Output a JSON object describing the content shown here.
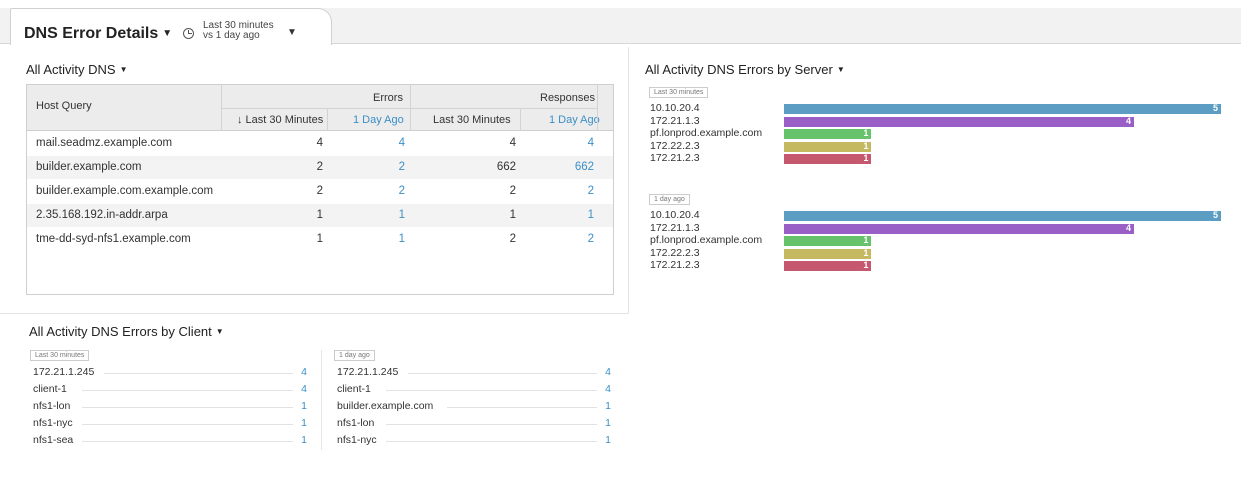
{
  "header": {
    "title": "DNS Error Details",
    "time_line1": "Last 30 minutes",
    "time_line2": "vs 1 day ago"
  },
  "table_section": {
    "title": "All Activity DNS",
    "col_host": "Host Query",
    "group_errors": "Errors",
    "group_responses": "Responses",
    "sub_last": "↓ Last 30 Minutes",
    "sub_ago": "1 Day Ago",
    "sub_last2": "Last 30 Minutes",
    "sub_ago2": "1 Day Ago",
    "rows": [
      {
        "host": "mail.seadmz.example.com",
        "err_last": "4",
        "err_ago": "4",
        "resp_last": "4",
        "resp_ago": "4"
      },
      {
        "host": "builder.example.com",
        "err_last": "2",
        "err_ago": "2",
        "resp_last": "662",
        "resp_ago": "662"
      },
      {
        "host": "builder.example.com.example.com",
        "err_last": "2",
        "err_ago": "2",
        "resp_last": "2",
        "resp_ago": "2"
      },
      {
        "host": "2.35.168.192.in-addr.arpa",
        "err_last": "1",
        "err_ago": "1",
        "resp_last": "1",
        "resp_ago": "1"
      },
      {
        "host": "tme-dd-syd-nfs1.example.com",
        "err_last": "1",
        "err_ago": "1",
        "resp_last": "2",
        "resp_ago": "2"
      }
    ]
  },
  "server_section": {
    "title": "All Activity DNS Errors by Server",
    "max_value": 5,
    "colors": [
      "#5b9dc3",
      "#9a5ec7",
      "#66c26b",
      "#c4b960",
      "#c5586e"
    ],
    "groups": [
      {
        "tag": "Last 30 minutes",
        "items": [
          {
            "label": "10.10.20.4",
            "value": "5"
          },
          {
            "label": "172.21.1.3",
            "value": "4"
          },
          {
            "label": "pf.lonprod.example.com",
            "value": "1"
          },
          {
            "label": "172.22.2.3",
            "value": "1"
          },
          {
            "label": "172.21.2.3",
            "value": "1"
          }
        ]
      },
      {
        "tag": "1 day ago",
        "items": [
          {
            "label": "10.10.20.4",
            "value": "5"
          },
          {
            "label": "172.21.1.3",
            "value": "4"
          },
          {
            "label": "pf.lonprod.example.com",
            "value": "1"
          },
          {
            "label": "172.22.2.3",
            "value": "1"
          },
          {
            "label": "172.21.2.3",
            "value": "1"
          }
        ]
      }
    ]
  },
  "client_section": {
    "title": "All Activity DNS Errors by Client",
    "lists": [
      {
        "tag": "Last 30 minutes",
        "items": [
          {
            "label": "172.21.1.245",
            "value": "4"
          },
          {
            "label": "client-1",
            "value": "4"
          },
          {
            "label": "nfs1-lon",
            "value": "1"
          },
          {
            "label": "nfs1-nyc",
            "value": "1"
          },
          {
            "label": "nfs1-sea",
            "value": "1"
          }
        ]
      },
      {
        "tag": "1 day ago",
        "items": [
          {
            "label": "172.21.1.245",
            "value": "4"
          },
          {
            "label": "client-1",
            "value": "4"
          },
          {
            "label": "builder.example.com",
            "value": "1"
          },
          {
            "label": "nfs1-lon",
            "value": "1"
          },
          {
            "label": "nfs1-nyc",
            "value": "1"
          }
        ]
      }
    ]
  }
}
